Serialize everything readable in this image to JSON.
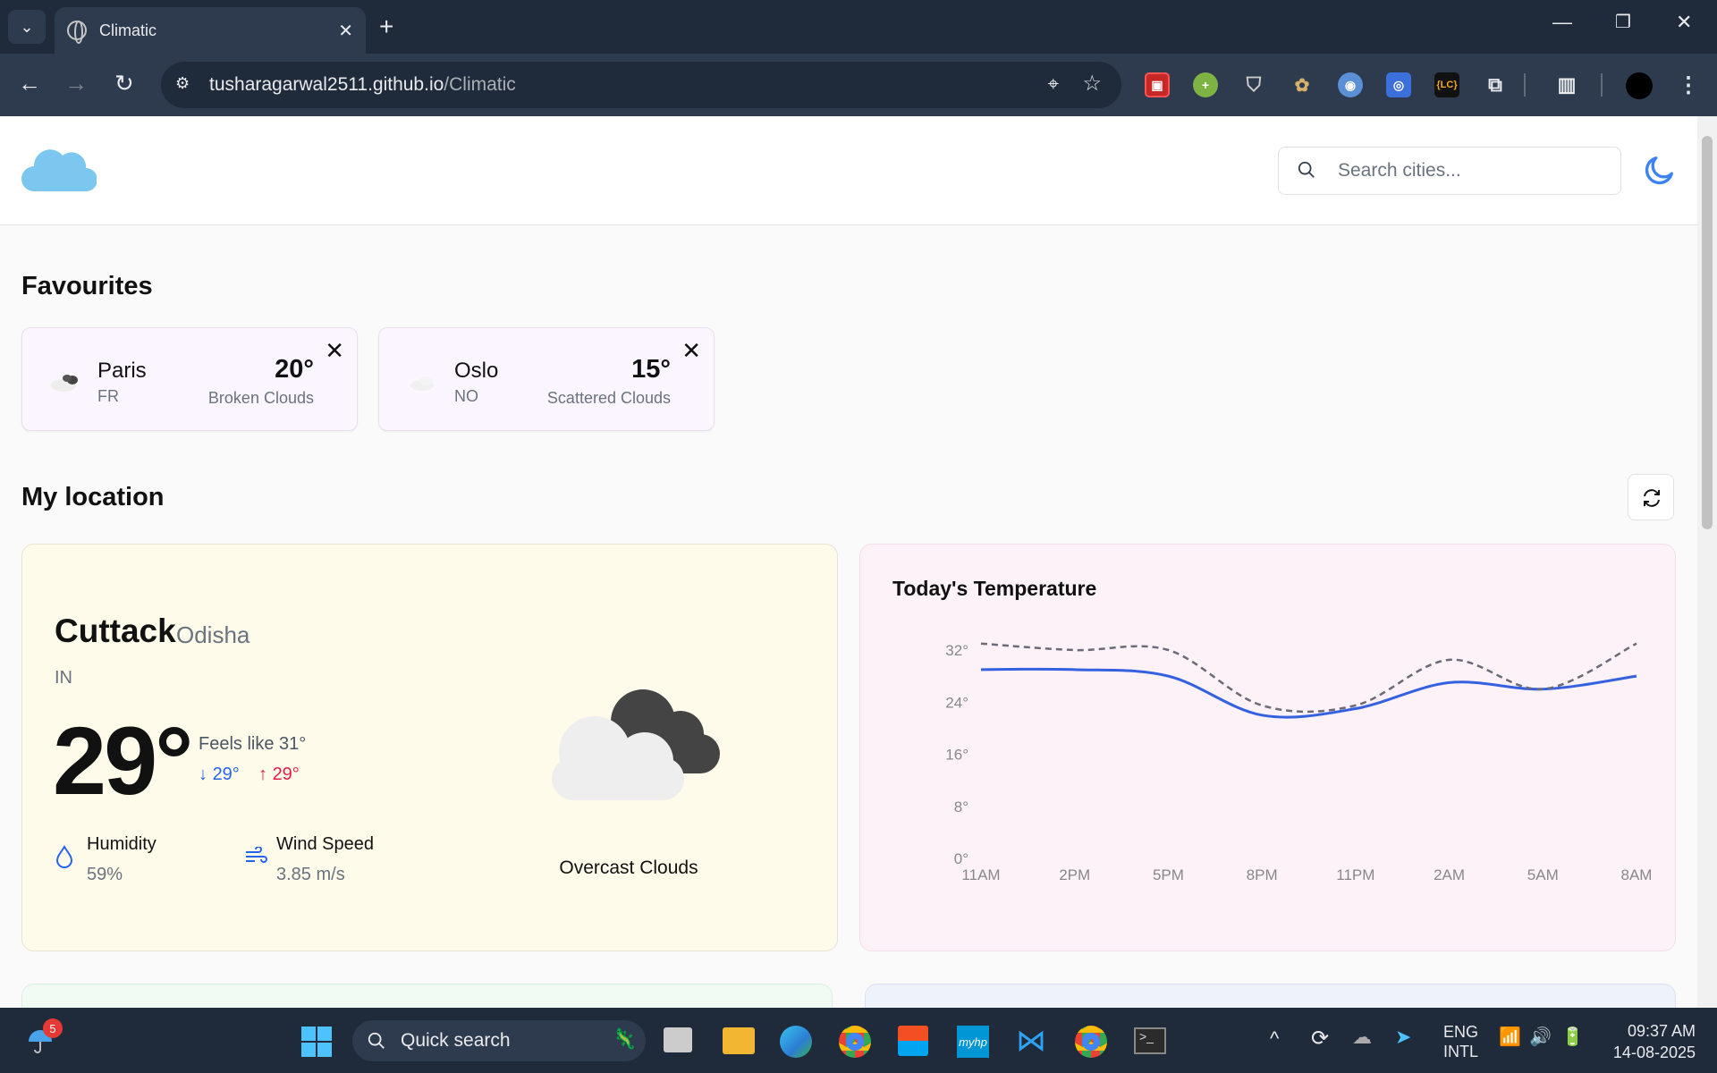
{
  "browser": {
    "tab_title": "Climatic",
    "url_host": "tusharagarwal2511.github.io",
    "url_path": "/Climatic"
  },
  "header": {
    "search_placeholder": "Search cities..."
  },
  "favourites": {
    "title": "Favourites",
    "items": [
      {
        "city": "Paris",
        "country": "FR",
        "temp": "20°",
        "desc": "Broken Clouds"
      },
      {
        "city": "Oslo",
        "country": "NO",
        "temp": "15°",
        "desc": "Scattered Clouds"
      }
    ]
  },
  "location": {
    "title": "My location",
    "city": "Cuttack",
    "region": "Odisha",
    "country": "IN",
    "temp": "29°",
    "feels_like": "Feels like 31°",
    "min": "29°",
    "max": "29°",
    "humidity_label": "Humidity",
    "humidity_value": "59%",
    "wind_label": "Wind Speed",
    "wind_value": "3.85 m/s",
    "condition": "Overcast Clouds"
  },
  "chart_data": {
    "type": "line",
    "title": "Today's Temperature",
    "x": [
      "11AM",
      "2PM",
      "5PM",
      "8PM",
      "11PM",
      "2AM",
      "5AM",
      "8AM"
    ],
    "yticks": [
      "0°",
      "8°",
      "16°",
      "24°",
      "32°"
    ],
    "ylim": [
      0,
      32
    ],
    "series": [
      {
        "values": [
          29,
          29,
          28,
          22,
          23,
          27,
          26,
          28
        ],
        "style": "solid",
        "color": "#3461e0"
      },
      {
        "values": [
          33,
          32,
          32,
          23.5,
          23.5,
          30.5,
          26,
          33
        ],
        "style": "dashed",
        "color": "#6b6b78"
      }
    ]
  },
  "taskbar": {
    "weather_badge": "5",
    "search": "Quick search",
    "lang1": "ENG",
    "lang2": "INTL",
    "time": "09:37 AM",
    "date": "14-08-2025"
  },
  "colors": {
    "accent": "#3b82f6",
    "cloud_blue": "#7cc7f0"
  }
}
